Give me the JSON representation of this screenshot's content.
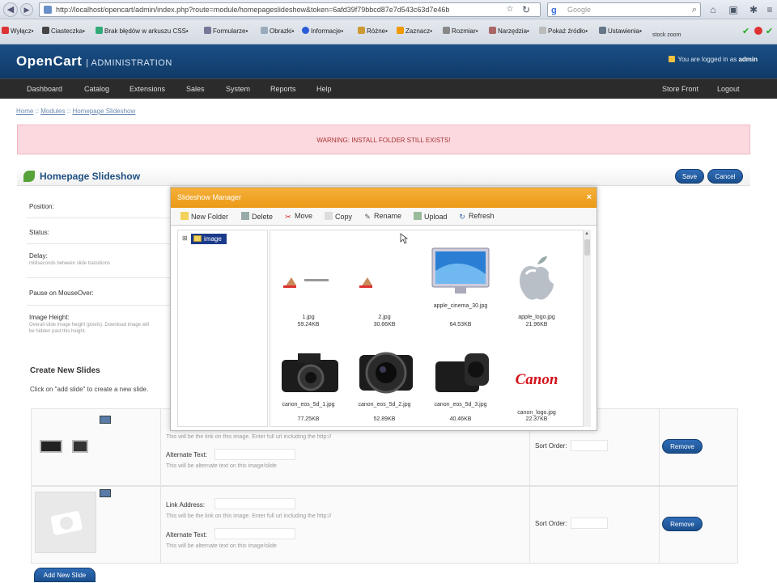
{
  "browser": {
    "url": "http://localhost/opencart/admin/index.php?route=module/homepageslideshow&token=6afd39f79bbcd87e7d543c63d7e46b",
    "search_placeholder": "Google",
    "search_engine_mark": "g",
    "bookmarks": [
      "Wyłącz•",
      "Ciasteczka•",
      "Brak błędów w arkuszu CSS•",
      "Formularze•",
      "Obrazki•",
      "Informacje•",
      "Różne•",
      "Zaznacz•",
      "Rozmiar•",
      "Narzędzia•",
      "Pokaż źródło•",
      "Ustawienia•",
      "stock zoom"
    ]
  },
  "admin": {
    "logo": "OpenCart",
    "logo_sub": "| ADMINISTRATION",
    "logged_in_text": "You are logged in as",
    "user": "admin",
    "menu": [
      "Dashboard",
      "Catalog",
      "Extensions",
      "Sales",
      "System",
      "Reports",
      "Help"
    ],
    "menu_right": [
      "Store Front",
      "Logout"
    ]
  },
  "breadcrumb": [
    "Home",
    "::",
    "Modules",
    "::",
    "Homepage Slideshow"
  ],
  "warning": "WARNING: INSTALL FOLDER STILL EXISTS!",
  "box": {
    "title": "Homepage Slideshow",
    "save": "Save",
    "cancel": "Cancel"
  },
  "form": {
    "position": "Position:",
    "status": "Status:",
    "delay": "Delay:",
    "delay_help": "milliseconds between slide transitions",
    "pause": "Pause on MouseOver:",
    "image_height": "Image Height:",
    "image_height_help": "Overall slide image height (pixels). Download image will be hidden past this height.",
    "create_title": "Create New Slides",
    "create_hint": "Click on \"add slide\" to create a new slide."
  },
  "slides": [
    {
      "link_help": "This will be the link on this image. Enter full url including the http://",
      "alt_label": "Alternate Text:",
      "alt_help": "This will be alternate text on this image/slide",
      "sort_label": "Sort Order:",
      "remove": "Remove"
    },
    {
      "link_label": "Link Address:",
      "link_help": "This will be the link on this image. Enter full url including the http://",
      "alt_label": "Alternate Text:",
      "alt_help": "This will be alternate text on this image/slide",
      "sort_label": "Sort Order:",
      "remove": "Remove"
    }
  ],
  "add_slide": "Add New Slide",
  "image_manager": {
    "title": "Slideshow Manager",
    "close": "×",
    "tools": [
      "New Folder",
      "Delete",
      "Move",
      "Copy",
      "Rename",
      "Upload",
      "Refresh"
    ],
    "tree_root": "image",
    "tree_toggle": "⊞",
    "scroll_up": "▲",
    "files": [
      {
        "name": "1.jpg",
        "size": "59.24KB"
      },
      {
        "name": "2.jpg",
        "size": "30.66KB"
      },
      {
        "name": "apple_cinema_30.jpg",
        "size": "64.53KB"
      },
      {
        "name": "apple_logo.jpg",
        "size": "21.96KB"
      },
      {
        "name": "canon_eos_5d_1.jpg",
        "size": "77.25KB"
      },
      {
        "name": "canon_eos_5d_2.jpg",
        "size": "52.89KB"
      },
      {
        "name": "canon_eos_5d_3.jpg",
        "size": "40.46KB"
      },
      {
        "name": "canon_logo.jpg",
        "size": "22.37KB"
      }
    ],
    "canon_word": "Canon"
  }
}
